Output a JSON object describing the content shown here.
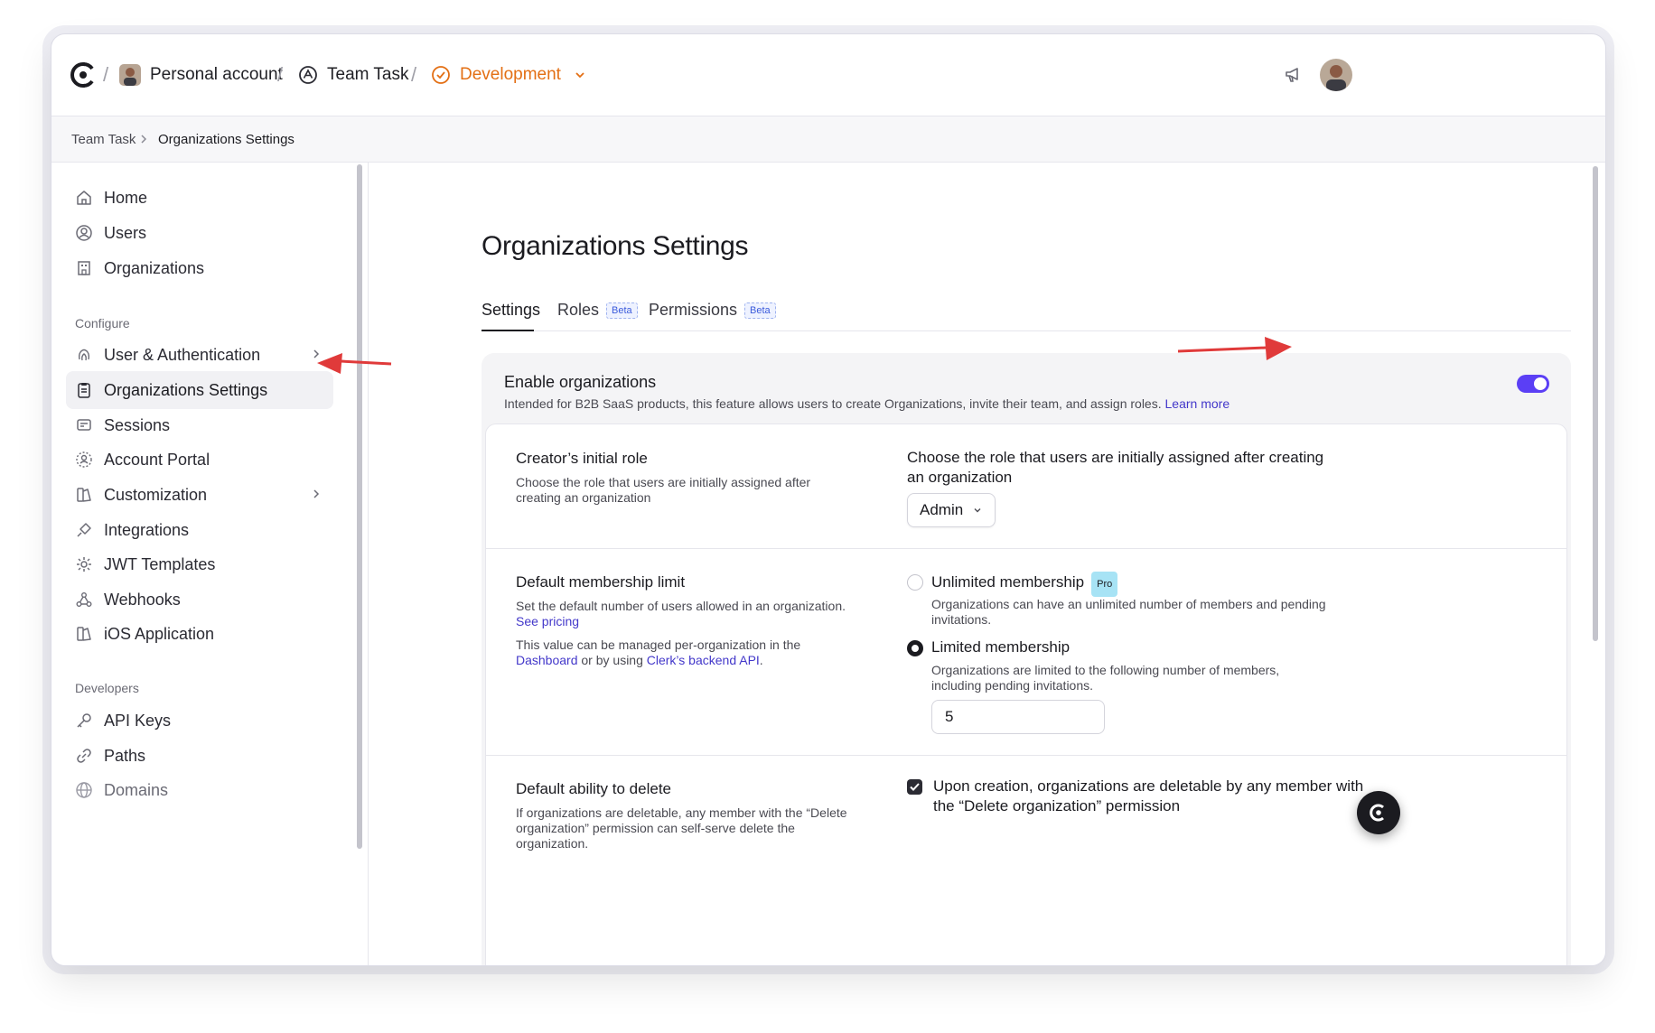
{
  "topbar": {
    "account": "Personal account",
    "app": "Team Task",
    "instance": "Development",
    "separator": "/"
  },
  "breadcrumb": {
    "parent": "Team Task",
    "current": "Organizations Settings"
  },
  "sidebar": {
    "items_top": [
      {
        "label": "Home",
        "icon": "home-icon"
      },
      {
        "label": "Users",
        "icon": "user-circle-icon"
      },
      {
        "label": "Organizations",
        "icon": "building-icon"
      }
    ],
    "configure_label": "Configure",
    "configure_items": [
      {
        "label": "User & Authentication",
        "icon": "fingerprint-icon"
      },
      {
        "label": "Organizations Settings",
        "icon": "clipboard-icon"
      },
      {
        "label": "Sessions",
        "icon": "session-icon"
      },
      {
        "label": "Account Portal",
        "icon": "portal-icon"
      },
      {
        "label": "Customization",
        "icon": "customization-icon"
      },
      {
        "label": "Integrations",
        "icon": "plug-icon"
      },
      {
        "label": "JWT Templates",
        "icon": "jwt-icon"
      },
      {
        "label": "Webhooks",
        "icon": "webhook-icon"
      },
      {
        "label": "iOS Application",
        "icon": "ios-icon"
      }
    ],
    "developers_label": "Developers",
    "developer_items": [
      {
        "label": "API Keys",
        "icon": "key-icon"
      },
      {
        "label": "Paths",
        "icon": "link-icon"
      },
      {
        "label": "Domains",
        "icon": "globe-icon"
      }
    ]
  },
  "main": {
    "title": "Organizations Settings",
    "tabs": [
      {
        "label": "Settings"
      },
      {
        "label": "Roles",
        "badge": "Beta"
      },
      {
        "label": "Permissions",
        "badge": "Beta"
      }
    ],
    "enable": {
      "title": "Enable organizations",
      "description": "Intended for B2B SaaS products, this feature allows users to create Organizations, invite their team, and assign roles.",
      "link": "Learn more",
      "enabled": true
    },
    "creator_role": {
      "title": "Creator’s initial role",
      "desc": "Choose the role that users are initially assigned after creating an organization",
      "right_text": "Choose the role that users are initially assigned after creating an organization",
      "selected": "Admin"
    },
    "membership": {
      "title": "Default membership limit",
      "desc1": "Set the default number of users allowed in an organization.",
      "pricing_link": "See pricing",
      "desc2a": "This value can be managed per-organization in the",
      "dashboard_link": "Dashboard",
      "desc2b": "or by using",
      "api_link": "Clerk’s backend API",
      "desc2c": ".",
      "unlimited_label": "Unlimited membership",
      "pro_badge": "Pro",
      "unlimited_desc": "Organizations can have an unlimited number of members and pending invitations.",
      "limited_label": "Limited membership",
      "limited_desc": "Organizations are limited to the following number of members, including pending invitations.",
      "limit_value": "5"
    },
    "delete": {
      "title": "Default ability to delete",
      "desc": "If organizations are deletable, any member with the “Delete organization” permission can self-serve delete the organization.",
      "checkbox_label": "Upon creation, organizations are deletable by any member with the “Delete organization” permission",
      "checked": true
    }
  },
  "colors": {
    "accent": "#5b3ff5",
    "instance": "#e36f14",
    "annotation_arrow": "#e03a3a",
    "link": "#4338ca"
  }
}
